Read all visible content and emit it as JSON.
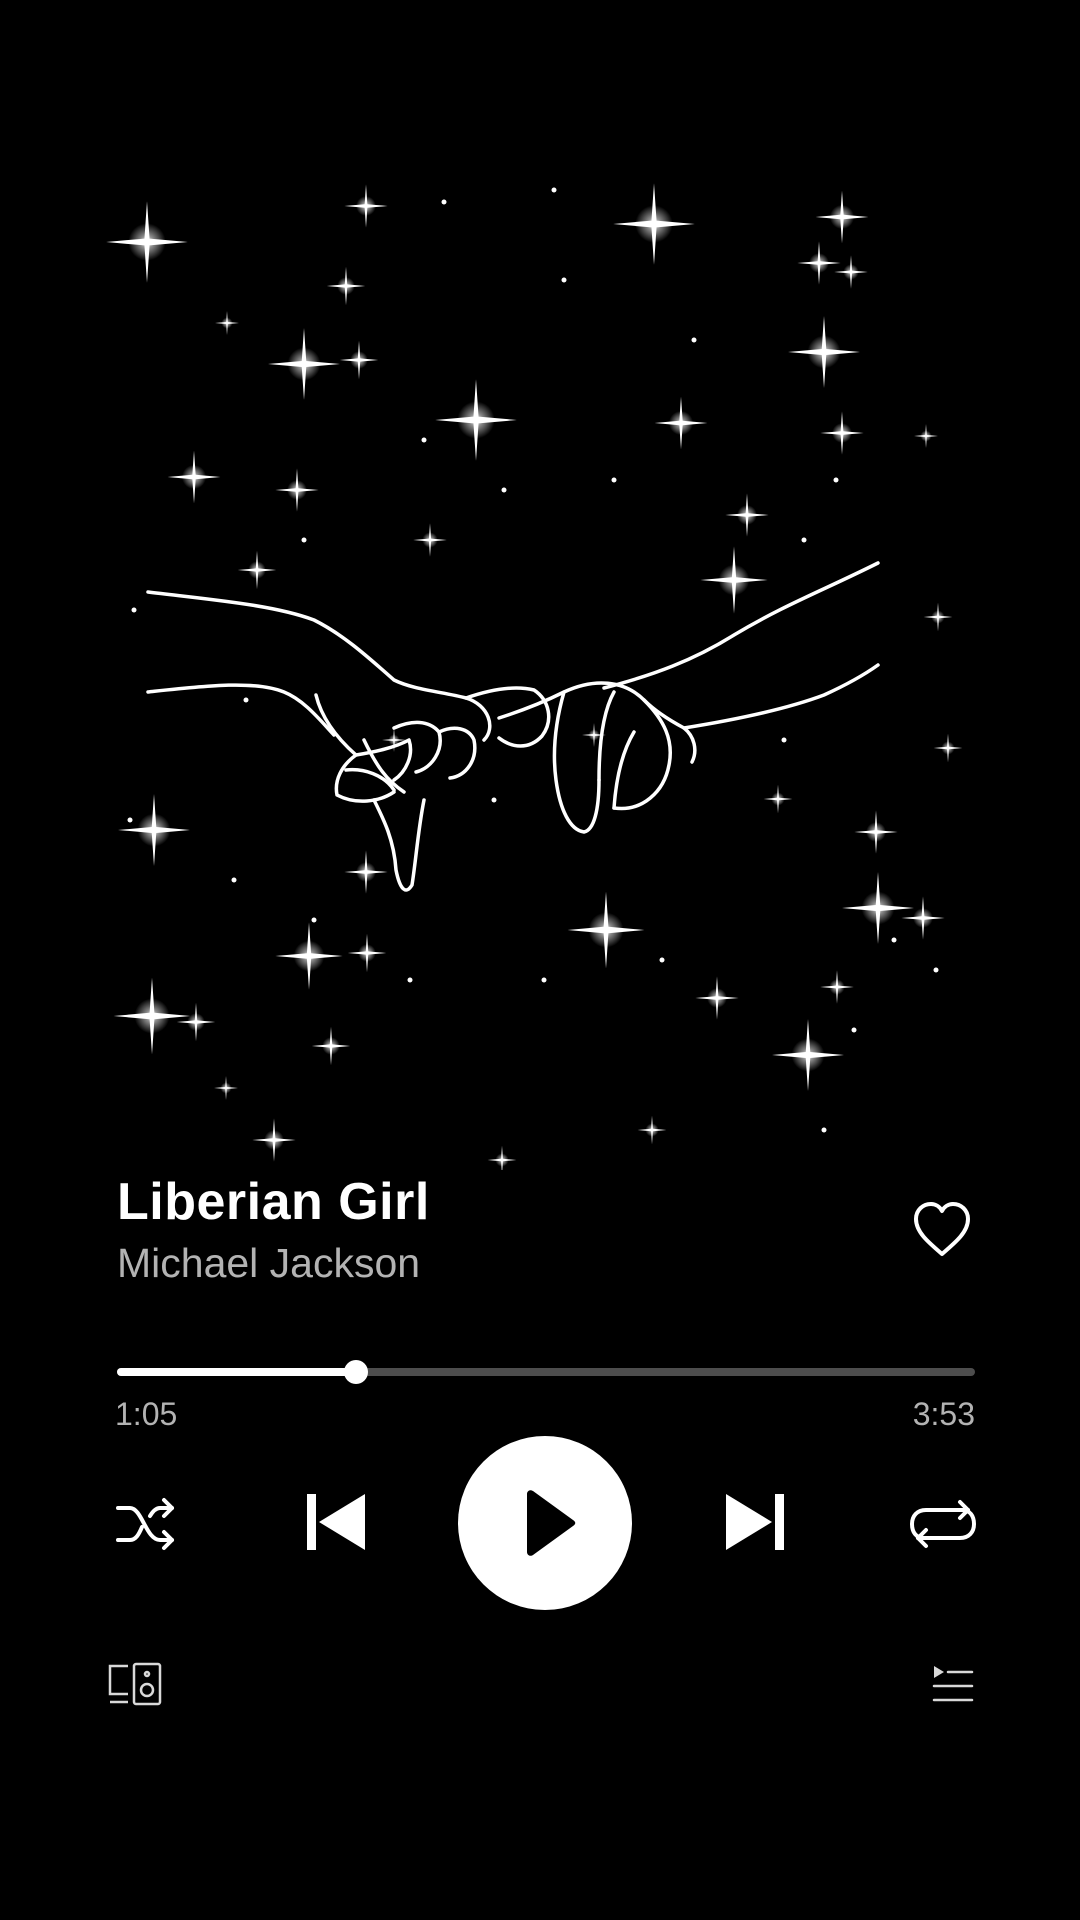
{
  "track": {
    "title": "Liberian Girl",
    "artist": "Michael Jackson",
    "liked": false
  },
  "playback": {
    "elapsed": "1:05",
    "total": "3:53",
    "progress_fraction": 0.279,
    "state": "paused"
  },
  "controls": {
    "shuffle_icon": "shuffle-icon",
    "previous_icon": "skip-previous-icon",
    "play_icon": "play-icon",
    "next_icon": "skip-next-icon",
    "repeat_icon": "repeat-icon",
    "devices_icon": "connect-devices-icon",
    "queue_icon": "queue-icon",
    "like_icon": "heart-outline-icon"
  },
  "colors": {
    "background": "#000000",
    "primary_text": "#ffffff",
    "secondary_text": "#b3b3b3",
    "progress_remaining": "#4d4d4d"
  }
}
